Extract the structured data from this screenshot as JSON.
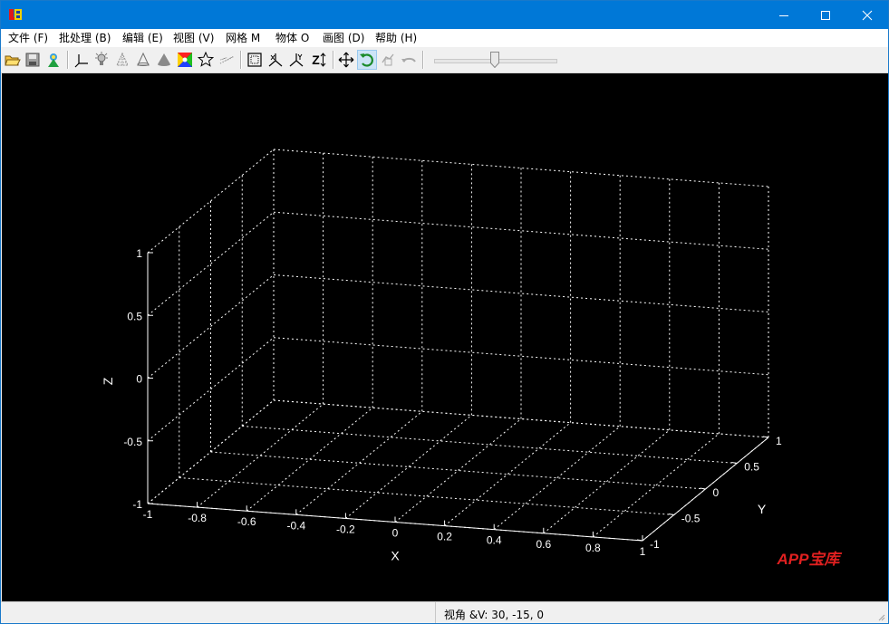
{
  "window": {
    "app_icon": "lb-app-icon",
    "controls": [
      "minimize-icon",
      "maximize-icon",
      "close-icon"
    ]
  },
  "menu": [
    {
      "label": "文件 (F)"
    },
    {
      "label": "批处理 (B)"
    },
    {
      "label": "编辑 (E)"
    },
    {
      "label": "视图 (V)"
    },
    {
      "label": "网格 M"
    },
    {
      "label": "物体 O"
    },
    {
      "label": "画图 (D)"
    },
    {
      "label": "帮助 (H)"
    }
  ],
  "toolbar": {
    "buttons": [
      "open-folder-icon",
      "save-icon",
      "tree-icon",
      "axes-icon",
      "light-bulb-icon",
      "cone-wire-icon",
      "cone-outline-icon",
      "cone-solid-icon",
      "color-palette-icon",
      "star-icon",
      "points-icon",
      "box-frame-icon",
      "axis-x-icon",
      "axis-y-icon",
      "axis-z-icon",
      "move-icon",
      "rotate-icon",
      "zoom-icon",
      "undo-icon"
    ],
    "active_button": "rotate-icon",
    "z_label": "Z",
    "slider_value": 0.5
  },
  "plot": {
    "background": "#000000",
    "grid_color": "#ffffff",
    "axis_labels": {
      "x": "X",
      "y": "Y",
      "z": "Z"
    },
    "x_ticks": [
      "-1",
      "-0.8",
      "-0.6",
      "-0.4",
      "-0.2",
      "0",
      "0.2",
      "0.4",
      "0.6",
      "0.8",
      "1"
    ],
    "y_ticks": [
      "-1",
      "-0.5",
      "0",
      "0.5",
      "1"
    ],
    "z_ticks": [
      "-1",
      "-0.5",
      "0",
      "0.5",
      "1"
    ],
    "watermark": "APP宝库",
    "watermark_color": "#e02020"
  },
  "status": {
    "text": "视角 &V: 30, -15, 0"
  }
}
